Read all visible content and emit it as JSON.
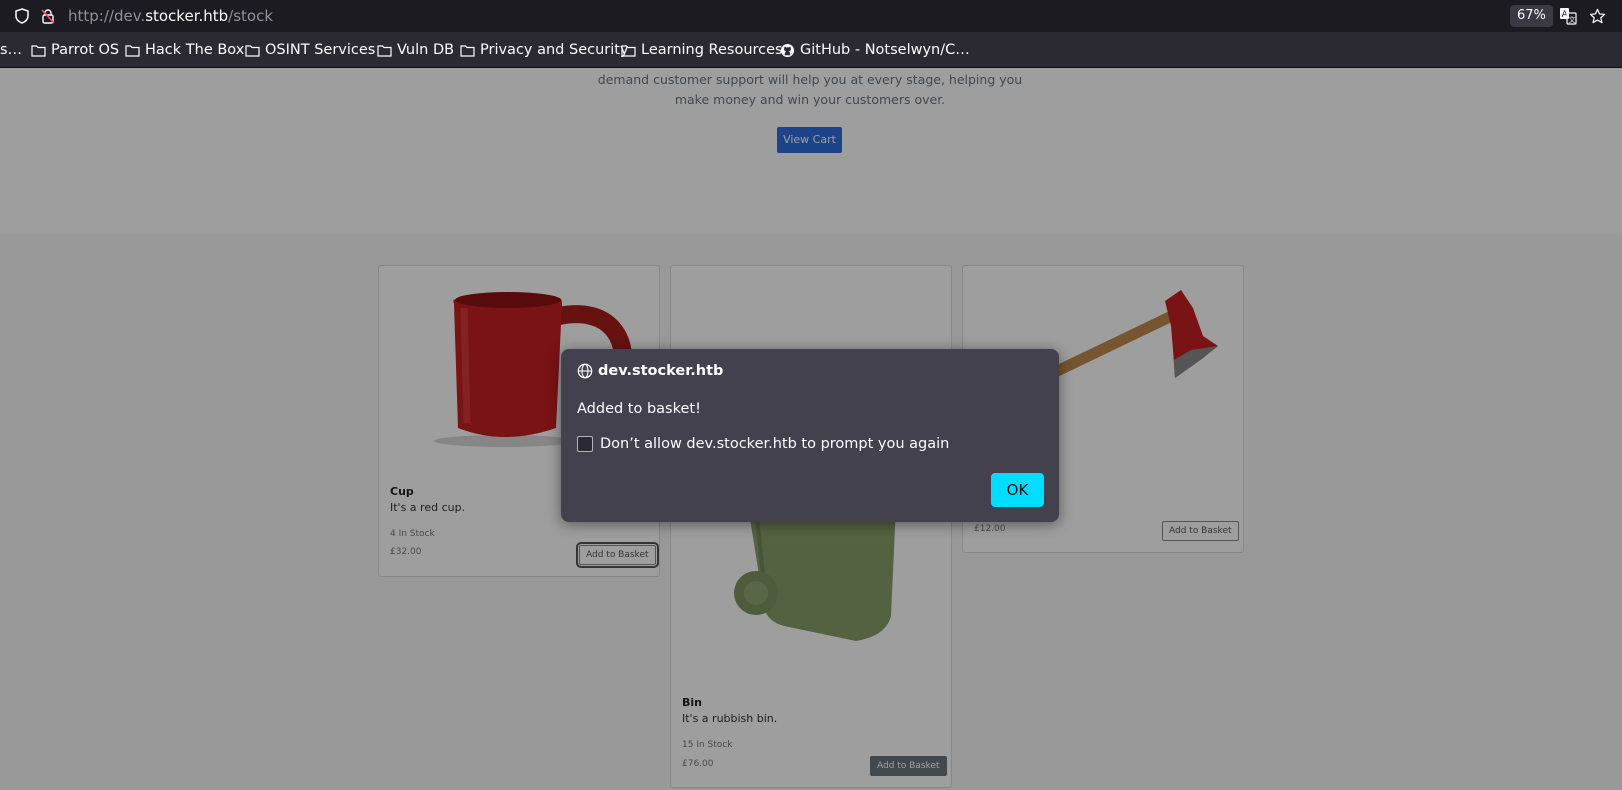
{
  "browser": {
    "url_prefix": "http://dev.",
    "url_host": "stocker.htb",
    "url_path": "/stock",
    "zoom": "67%"
  },
  "bookmarks": [
    {
      "label": "s…"
    },
    {
      "label": "Parrot OS"
    },
    {
      "label": "Hack The Box"
    },
    {
      "label": "OSINT Services"
    },
    {
      "label": "Vuln DB"
    },
    {
      "label": "Privacy and Security"
    },
    {
      "label": "Learning Resources"
    },
    {
      "label": "GitHub - Notselwyn/C…"
    }
  ],
  "hero": {
    "line1": "demand customer support will help you at every stage, helping you",
    "line2": "make money and win your customers over.",
    "view_cart": "View Cart"
  },
  "products": [
    {
      "name": "Cup",
      "description": "It's a red cup.",
      "stock": "4 In Stock",
      "price": "£32.00",
      "button": "Add to Basket"
    },
    {
      "name": "Bin",
      "description": "It's a rubbish bin.",
      "stock": "15 In Stock",
      "price": "£76.00",
      "button": "Add to Basket"
    },
    {
      "name": "",
      "description": "",
      "stock": "",
      "price": "£12.00",
      "button": "Add to Basket"
    }
  ],
  "dialog": {
    "origin": "dev.stocker.htb",
    "message": "Added to basket!",
    "checkbox_label": "Don’t allow dev.stocker.htb to prompt you again",
    "ok": "OK"
  },
  "colors": {
    "accent": "#00ddff",
    "view_cart": "#2f6fdc",
    "dialog_bg": "#42414d"
  }
}
